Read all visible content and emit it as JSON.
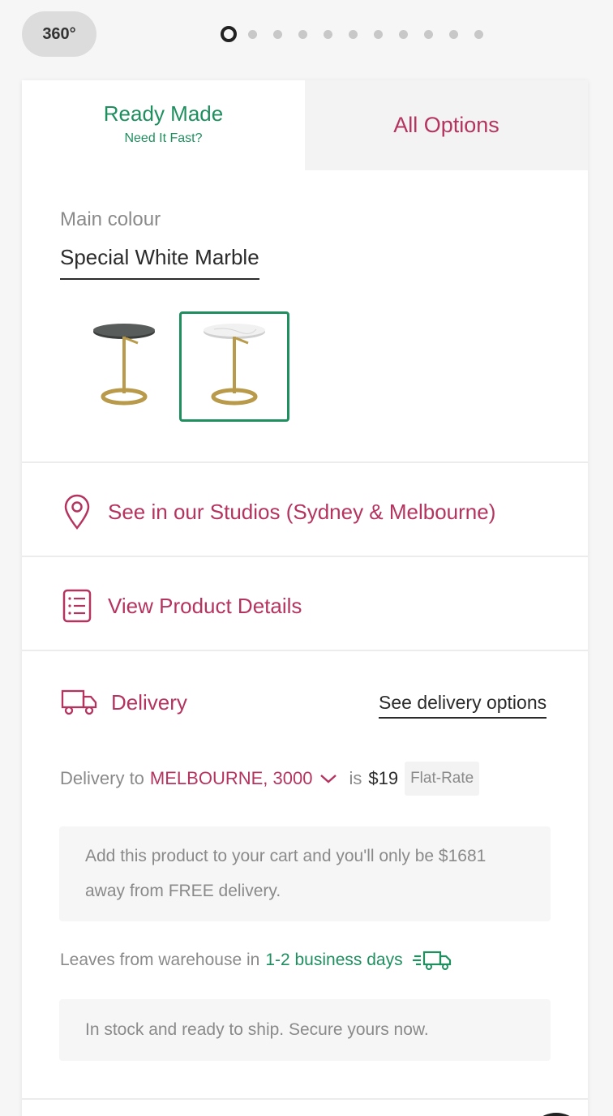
{
  "top": {
    "btn_360": "360°",
    "carousel_dots": 11,
    "active_dot": 0
  },
  "tabs": {
    "ready_title": "Ready Made",
    "ready_subtitle": "Need It Fast?",
    "all_options": "All Options"
  },
  "colour": {
    "label": "Main colour",
    "value": "Special White Marble",
    "swatches": [
      {
        "name": "smoked-glass",
        "selected": false
      },
      {
        "name": "special-white-marble",
        "selected": true
      }
    ]
  },
  "links": {
    "studios": "See in our Studios (Sydney & Melbourne)",
    "product_details": "View Product Details"
  },
  "delivery": {
    "title": "Delivery",
    "see_options": "See delivery options",
    "to_label": "Delivery to",
    "location": "MELBOURNE, 3000",
    "is_label": "is",
    "price": "$19",
    "badge": "Flat-Rate",
    "note": "Add this product to your cart and you'll only be $1681 away from FREE delivery.",
    "leaves_label": "Leaves from warehouse in",
    "leaves_days": "1-2 business days",
    "stock_note": "In stock and ready to ship. Secure yours now."
  },
  "colors": {
    "green": "#1f8f5f",
    "pink": "#b5345f",
    "gray_text": "#8a8a8a"
  }
}
